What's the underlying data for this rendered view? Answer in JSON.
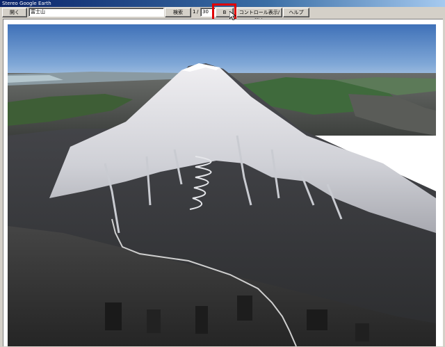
{
  "window": {
    "title": "Stereo Google Earth"
  },
  "toolbar": {
    "open_label": "開く",
    "search_value": "富士山",
    "search_label": "検索",
    "page_current": "1",
    "page_separator": "/",
    "page_total": "30",
    "next_label": "B",
    "toggle_controls_label": "コントロール表示/消去",
    "help_label": "ヘルプ"
  },
  "colors": {
    "highlight": "#e00000",
    "window_face": "#d4d0c8",
    "title_active": "#0a246a"
  },
  "view": {
    "content": "aerial-3d-terrain-mount-fuji"
  }
}
